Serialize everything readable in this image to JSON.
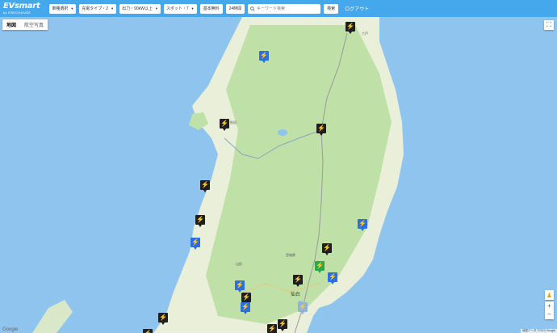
{
  "header": {
    "logo_main": "EVsmart",
    "logo_sub": "by ENECHANGE",
    "filters": [
      {
        "label": "車種選択"
      },
      {
        "label": "充電タイプ・2"
      },
      {
        "label": "出力・90kW以上"
      },
      {
        "label": "スポット・7"
      }
    ],
    "buttons": {
      "basic_fee": "基本無料",
      "hours24": "24時間",
      "search": "検索"
    },
    "search_placeholder": "キーワード検索",
    "logout": "ログアウト"
  },
  "map": {
    "type_tabs": [
      "地図",
      "航空写真"
    ],
    "active_tab": "地図",
    "places": [
      "六戸",
      "秋田",
      "仙台",
      "山形",
      "宮城県"
    ],
    "attribution": "地図データ ©2024 Google",
    "google": "Google",
    "colors": {
      "sea": "#8fc4ef",
      "land": "#e9efd9",
      "forest": "#bfe0a7",
      "topbar": "#45a7ec"
    },
    "marker_types": {
      "black": "fast-charger-icon",
      "blue": "charger-icon-blue",
      "green": "charger-icon-green"
    }
  }
}
